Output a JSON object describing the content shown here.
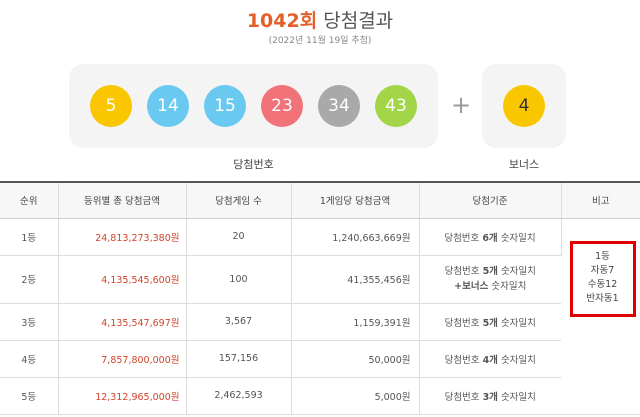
{
  "header": {
    "round_num": "1042회",
    "round_rest": " 당첨결과",
    "date": "(2022년 11월 19일 추첨)"
  },
  "balls": {
    "main": [
      {
        "num": "5",
        "color": "#f9c600"
      },
      {
        "num": "14",
        "color": "#6ac9f0"
      },
      {
        "num": "15",
        "color": "#6ac9f0"
      },
      {
        "num": "23",
        "color": "#f2727a"
      },
      {
        "num": "34",
        "color": "#a9a9a9"
      },
      {
        "num": "43",
        "color": "#a3d548"
      }
    ],
    "plus": "+",
    "bonus": {
      "num": "4",
      "color": "#f9c600"
    },
    "main_label": "당첨번호",
    "bonus_label": "보너스"
  },
  "table": {
    "headers": [
      "순위",
      "등위별 총 당첨금액",
      "당첨게임 수",
      "1게임당 당첨금액",
      "당첨기준",
      "비고"
    ],
    "rows": [
      {
        "rank": "1등",
        "total": "24,813,273,380원",
        "games": "20",
        "per_game": "1,240,663,669원",
        "crit_pre": "당첨번호 ",
        "crit_strong": "6개",
        "crit_post": " 숫자일치"
      },
      {
        "rank": "2등",
        "total": "4,135,545,600원",
        "games": "100",
        "per_game": "41,355,456원",
        "crit_pre": "당첨번호 ",
        "crit_strong": "5개",
        "crit_post": " 숫자일치",
        "crit2_strong": "+보너스",
        "crit2_post": " 숫자일치"
      },
      {
        "rank": "3등",
        "total": "4,135,547,697원",
        "games": "3,567",
        "per_game": "1,159,391원",
        "crit_pre": "당첨번호 ",
        "crit_strong": "5개",
        "crit_post": " 숫자일치"
      },
      {
        "rank": "4등",
        "total": "7,857,800,000원",
        "games": "157,156",
        "per_game": "50,000원",
        "crit_pre": "당첨번호 ",
        "crit_strong": "4개",
        "crit_post": " 숫자일치"
      },
      {
        "rank": "5등",
        "total": "12,312,965,000원",
        "games": "2,462,593",
        "per_game": "5,000원",
        "crit_pre": "당첨번호 ",
        "crit_strong": "3개",
        "crit_post": " 숫자일치"
      }
    ],
    "note_lines": [
      "1등",
      "자동7",
      "수동12",
      "반자동1"
    ],
    "highlight_color": "#e00000"
  }
}
